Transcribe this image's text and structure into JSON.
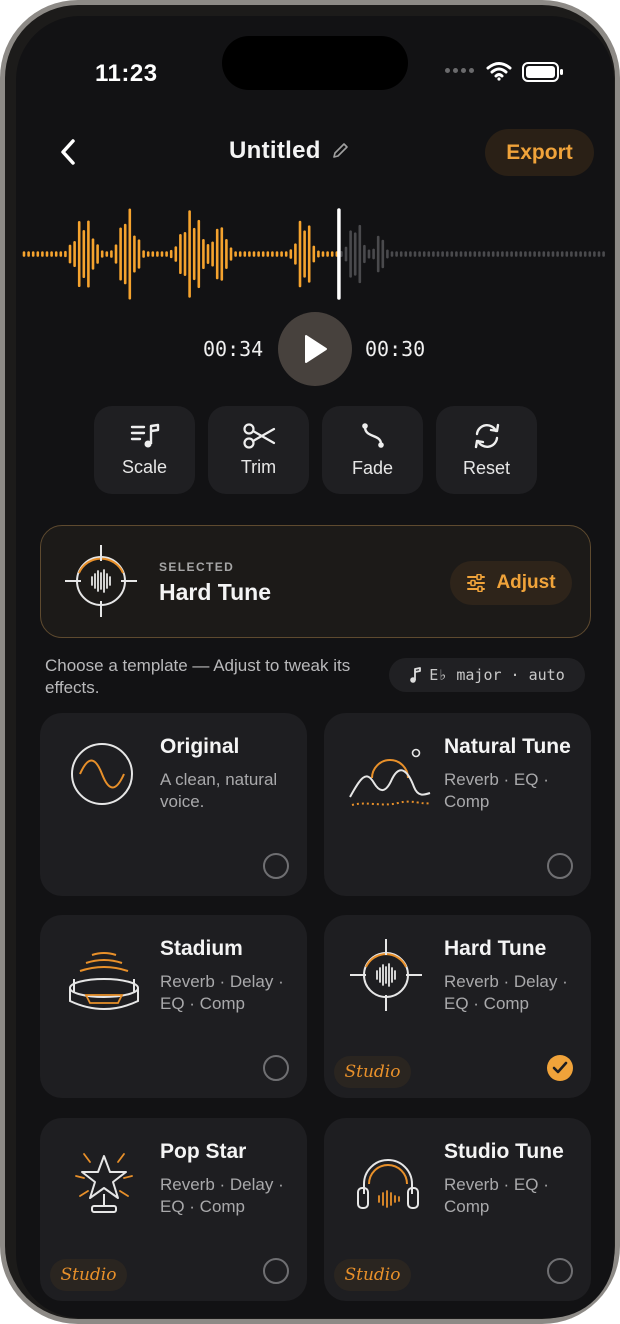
{
  "status": {
    "time": "11:23"
  },
  "header": {
    "title": "Untitled",
    "export_label": "Export"
  },
  "player": {
    "elapsed": "00:34",
    "remaining": "00:30",
    "progress": 0.54
  },
  "tools": [
    {
      "label": "Scale",
      "icon": "scale-icon"
    },
    {
      "label": "Trim",
      "icon": "scissors-icon"
    },
    {
      "label": "Fade",
      "icon": "fade-icon"
    },
    {
      "label": "Reset",
      "icon": "reset-icon"
    }
  ],
  "selected": {
    "caption": "SELECTED",
    "name": "Hard Tune",
    "adjust_label": "Adjust"
  },
  "hint": {
    "text": "Choose a template — Adjust to tweak its effects.",
    "key": "E♭ major · auto"
  },
  "templates": [
    {
      "name": "Original",
      "desc": "A clean, natural voice.",
      "icon": "sine-wave-icon",
      "studio": false,
      "selected": false
    },
    {
      "name": "Natural Tune",
      "desc": "Reverb · EQ · Comp",
      "icon": "hills-sun-icon",
      "studio": false,
      "selected": false
    },
    {
      "name": "Stadium",
      "desc": "Reverb · Delay · EQ · Comp",
      "icon": "stadium-icon",
      "studio": false,
      "selected": false
    },
    {
      "name": "Hard Tune",
      "desc": "Reverb · Delay · EQ · Comp",
      "icon": "crosshair-wave-icon",
      "studio": true,
      "selected": true
    },
    {
      "name": "Pop Star",
      "desc": "Reverb · Delay · EQ · Comp",
      "icon": "star-trophy-icon",
      "studio": true,
      "selected": false
    },
    {
      "name": "Studio Tune",
      "desc": "Reverb · EQ · Comp",
      "icon": "headphones-icon",
      "studio": true,
      "selected": false
    }
  ],
  "studio_badge": "Studio",
  "colors": {
    "accent": "#f0a33a",
    "background": "#121214",
    "card": "#1e1e21",
    "played_wave": "#f5a32e",
    "unplayed_wave": "#4a4a4d"
  }
}
